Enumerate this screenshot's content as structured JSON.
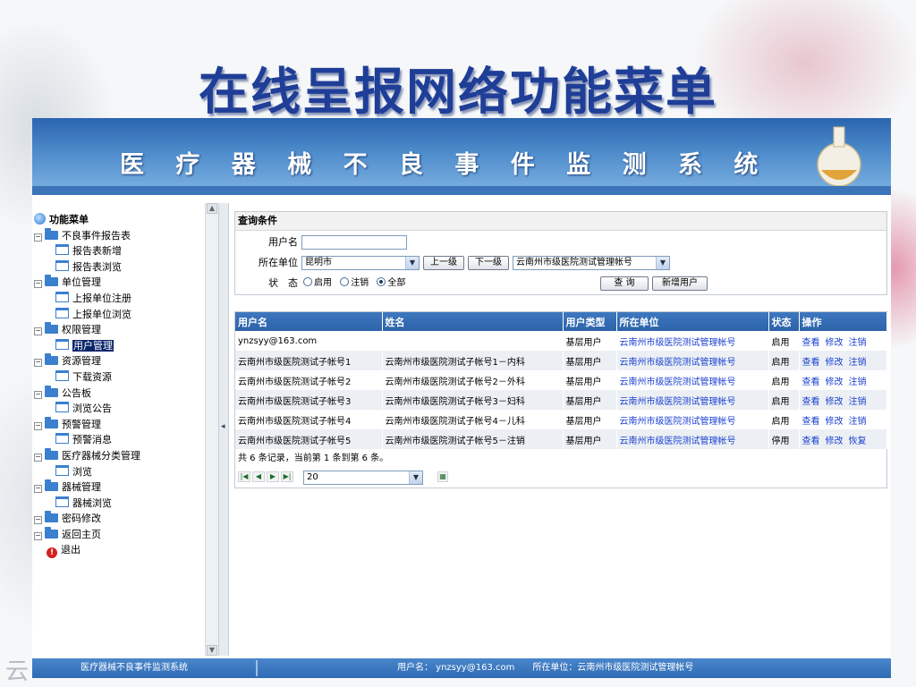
{
  "slide": {
    "title": "在线呈报网络功能菜单",
    "watermark": "云"
  },
  "banner": {
    "system_name": "医 疗 器 械 不 良 事 件 监 测 系 统"
  },
  "menu": {
    "root": "功能菜单",
    "items": [
      {
        "label": "不良事件报告表",
        "type": "folder"
      },
      {
        "label": "报告表新增",
        "type": "page"
      },
      {
        "label": "报告表浏览",
        "type": "page"
      },
      {
        "label": "单位管理",
        "type": "folder"
      },
      {
        "label": "上报单位注册",
        "type": "page"
      },
      {
        "label": "上报单位浏览",
        "type": "page"
      },
      {
        "label": "权限管理",
        "type": "folder"
      },
      {
        "label": "用户管理",
        "type": "page",
        "selected": true
      },
      {
        "label": "资源管理",
        "type": "folder"
      },
      {
        "label": "下载资源",
        "type": "page"
      },
      {
        "label": "公告板",
        "type": "folder"
      },
      {
        "label": "浏览公告",
        "type": "page"
      },
      {
        "label": "预警管理",
        "type": "folder"
      },
      {
        "label": "预警消息",
        "type": "page"
      },
      {
        "label": "医疗器械分类管理",
        "type": "folder"
      },
      {
        "label": "浏览",
        "type": "page"
      },
      {
        "label": "器械管理",
        "type": "folder"
      },
      {
        "label": "器械浏览",
        "type": "page"
      },
      {
        "label": "密码修改",
        "type": "folder"
      },
      {
        "label": "返回主页",
        "type": "folder"
      },
      {
        "label": "退出",
        "type": "exit"
      }
    ]
  },
  "query": {
    "header": "查询条件",
    "username_label": "用户名",
    "username_value": "",
    "unit_label": "所在单位",
    "unit_city": "昆明市",
    "btn_up": "上一级",
    "btn_down": "下一级",
    "unit_account": "云南州市级医院测试管理帐号",
    "status_label": "状　态",
    "status_options": [
      "启用",
      "注销",
      "全部"
    ],
    "status_selected": "全部",
    "btn_search": "查 询",
    "btn_add": "新增用户"
  },
  "grid": {
    "columns": [
      "用户名",
      "姓名",
      "用户类型",
      "所在单位",
      "状态",
      "操作"
    ],
    "rows": [
      {
        "username": "ynzsyy@163.com",
        "name": "",
        "type": "基层用户",
        "unit": "云南州市级医院测试管理帐号",
        "status": "启用",
        "actions": [
          "查看",
          "修改",
          "注销"
        ]
      },
      {
        "username": "云南州市级医院测试子帐号1",
        "name": "云南州市级医院测试子帐号1－内科",
        "type": "基层用户",
        "unit": "云南州市级医院测试管理帐号",
        "status": "启用",
        "actions": [
          "查看",
          "修改",
          "注销"
        ]
      },
      {
        "username": "云南州市级医院测试子帐号2",
        "name": "云南州市级医院测试子帐号2－外科",
        "type": "基层用户",
        "unit": "云南州市级医院测试管理帐号",
        "status": "启用",
        "actions": [
          "查看",
          "修改",
          "注销"
        ]
      },
      {
        "username": "云南州市级医院测试子帐号3",
        "name": "云南州市级医院测试子帐号3－妇科",
        "type": "基层用户",
        "unit": "云南州市级医院测试管理帐号",
        "status": "启用",
        "actions": [
          "查看",
          "修改",
          "注销"
        ]
      },
      {
        "username": "云南州市级医院测试子帐号4",
        "name": "云南州市级医院测试子帐号4－儿科",
        "type": "基层用户",
        "unit": "云南州市级医院测试管理帐号",
        "status": "启用",
        "actions": [
          "查看",
          "修改",
          "注销"
        ]
      },
      {
        "username": "云南州市级医院测试子帐号5",
        "name": "云南州市级医院测试子帐号5－注销",
        "type": "基层用户",
        "unit": "云南州市级医院测试管理帐号",
        "status": "停用",
        "actions": [
          "查看",
          "修改",
          "恢复"
        ]
      }
    ],
    "summary": "共 6 条记录，当前第 1 条到第 6 条。",
    "page_size": "20"
  },
  "statusbar": {
    "system": "医疗器械不良事件监测系统",
    "user": "用户名： ynzsyy@163.com　　所在单位：云南州市级医院测试管理帐号"
  },
  "colors": {
    "title": "#1f3e97",
    "banner": "#2a64b0",
    "grid_header": "#3e78bf",
    "link": "#1a3fd0"
  }
}
